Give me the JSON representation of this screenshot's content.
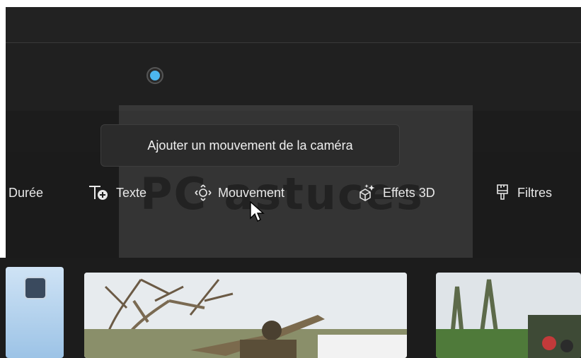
{
  "timeline": {
    "progress_fraction": 0.26
  },
  "tooltip": {
    "text": "Ajouter un mouvement de la caméra"
  },
  "toolbar": {
    "items": [
      {
        "label": "Durée",
        "icon": "none"
      },
      {
        "label": "Texte",
        "icon": "text-add-icon"
      },
      {
        "label": "Mouvement",
        "icon": "motion-icon"
      },
      {
        "label": "Effets 3D",
        "icon": "3d-effects-icon"
      },
      {
        "label": "Filtres",
        "icon": "filter-brush-icon"
      }
    ]
  },
  "watermark": {
    "text": "PC astuces"
  },
  "colors": {
    "accent": "#4cb6ef",
    "background": "#1f1f1f",
    "text": "#e8e8e8"
  }
}
